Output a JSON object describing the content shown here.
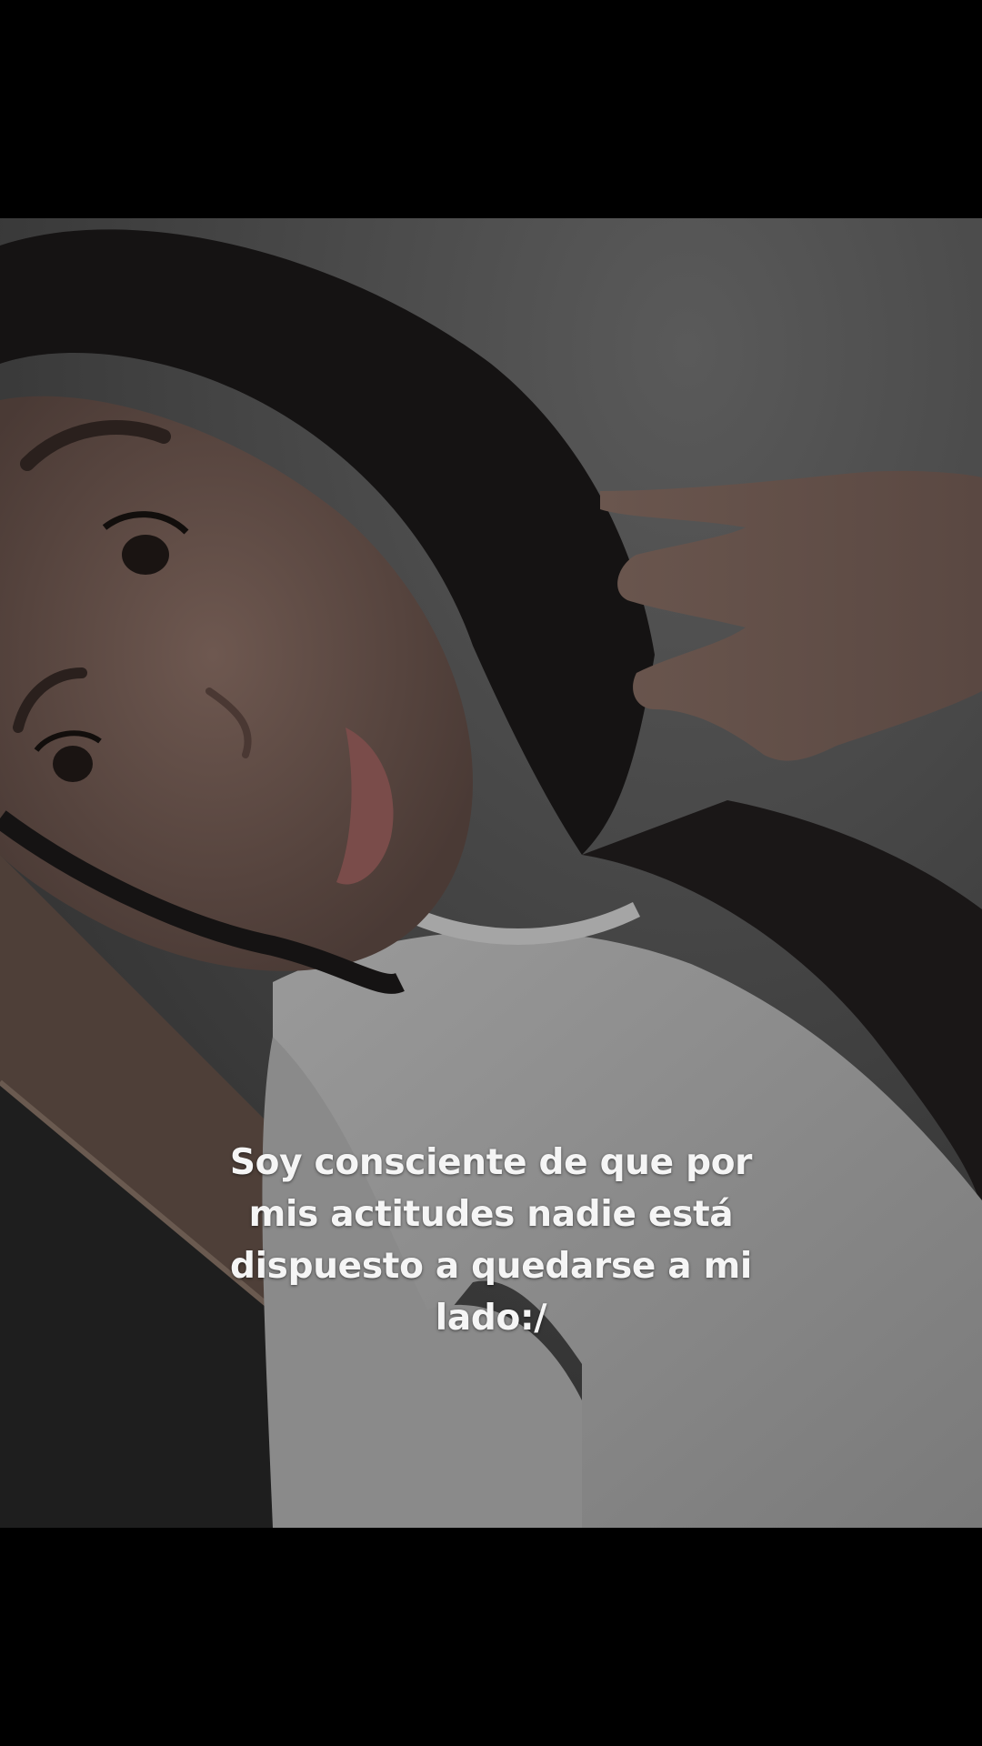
{
  "video": {
    "caption_lines": [
      "Soy consciente de que por",
      "mis actitudes nadie está",
      "dispuesto a quedarse a mi",
      "lado:/"
    ]
  },
  "colors": {
    "letterbox": "#000000",
    "caption_text": "#f5f5f5",
    "shirt": "#8f8f8f",
    "hair": "#151313",
    "skin": "#5e4a43",
    "wall": "#4a4a4a"
  }
}
